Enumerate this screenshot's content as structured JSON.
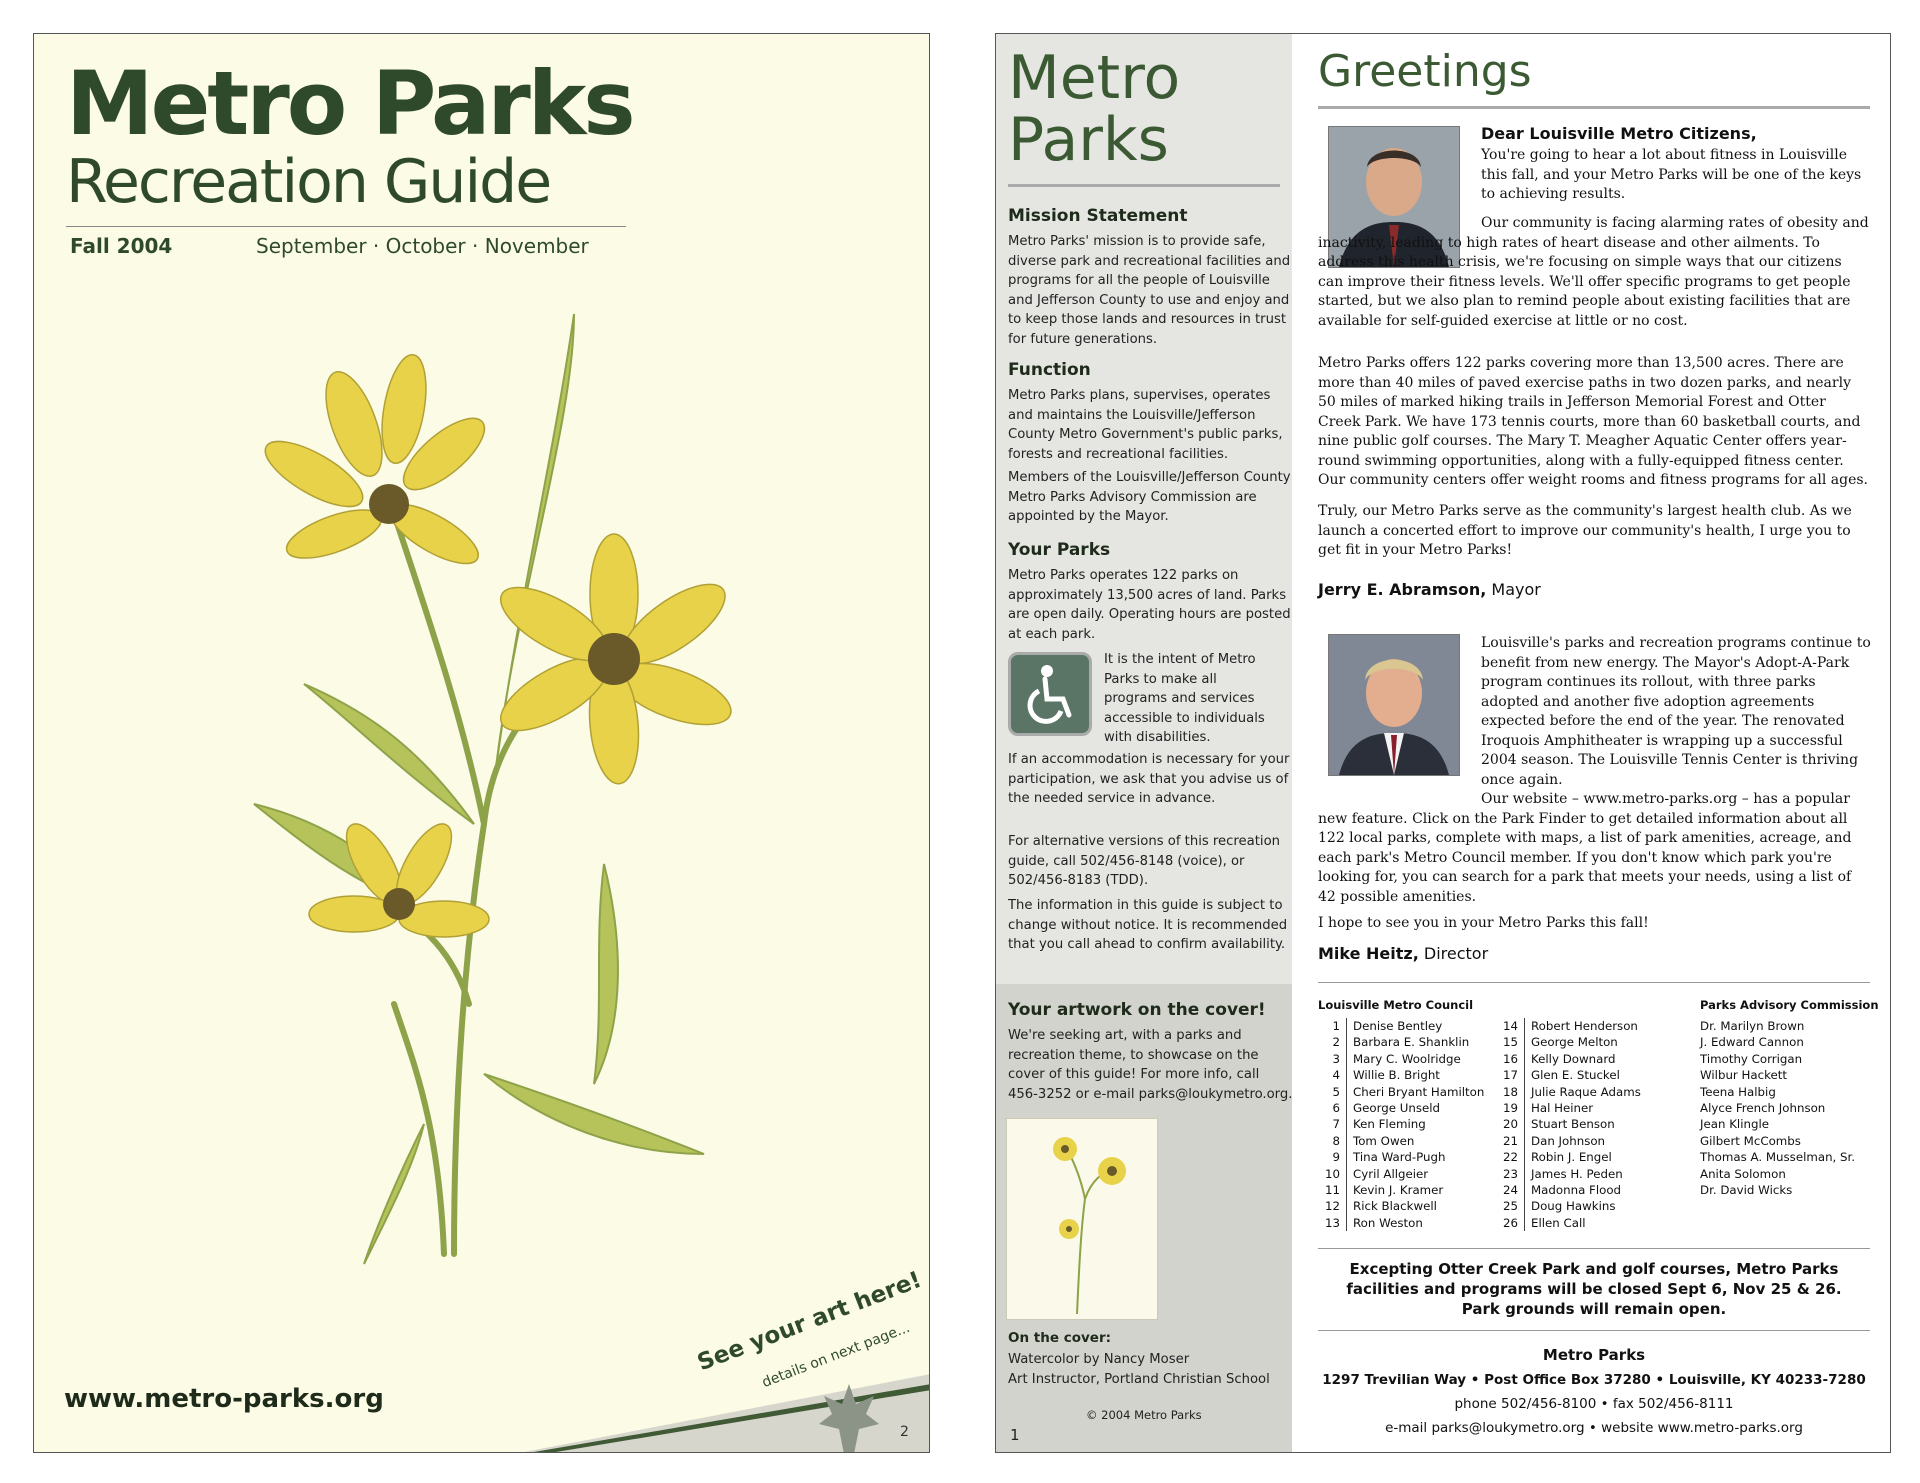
{
  "cover": {
    "title_line1": "Metro Parks",
    "title_line2": "Recreation Guide",
    "season": "Fall 2004",
    "months": "September · October · November",
    "website": "www.metro-parks.org",
    "tagline": "See your art here!",
    "tagline_sub": "details on next page...",
    "page_number": "2"
  },
  "sidebar": {
    "title_line1": "Metro",
    "title_line2": "Parks",
    "mission_heading": "Mission Statement",
    "mission_text": "Metro Parks' mission is to provide safe, diverse park and recreational facilities and programs for all the people of Louisville and Jefferson County to use and enjoy and to keep those lands and resources in trust for future generations.",
    "function_heading": "Function",
    "function_text": "Metro Parks plans, supervises, operates and maintains the Louisville/Jefferson County Metro Government's public parks, forests and recreational facilities.",
    "function_text2": "Members of the Louisville/Jefferson County Metro Parks Advisory Commission are appointed by the Mayor.",
    "parks_heading": "Your Parks",
    "parks_text": "Metro Parks operates 122 parks on approximately 13,500 acres of land. Parks are open daily. Operating hours are posted at each park.",
    "access_text": "It is the intent of Metro Parks to make all programs and services accessible to individuals with disabilities.",
    "accommodation_text": "If an accommodation is necessary for your participation, we ask that you advise us of the needed service in advance.",
    "alt_versions_text": "For alternative versions of this recreation guide, call 502/456-8148 (voice), or 502/456-8183 (TDD).",
    "change_text": "The information in this guide is subject to change without notice. It is recommended that you call ahead to confirm availability.",
    "artwork_heading": "Your artwork on the cover!",
    "artwork_text": "We're seeking art, with a parks and recreation theme, to showcase on the cover of this guide! For more info, call 456-3252 or e-mail parks@loukymetro.org.",
    "on_cover_label": "On the cover:",
    "on_cover_line1": "Watercolor by Nancy Moser",
    "on_cover_line2": "Art Instructor, Portland Christian School",
    "copyright": "© 2004 Metro Parks",
    "page_number": "1"
  },
  "greetings": {
    "heading": "Greetings",
    "salutation": "Dear Louisville Metro Citizens,",
    "mayor_p1": "You're going to hear a lot about fitness in Louisville this fall, and your Metro Parks will be one of the keys to achieving results.",
    "mayor_p2": "Our community is facing alarming rates of obesity and inactivity, leading to high rates of heart disease and other ailments. To address this health crisis, we're focusing on simple ways that our citizens can improve their fitness levels. We'll offer specific programs to get people started, but we also plan to remind people about existing facilities that are available for self-guided exercise at little or no cost.",
    "mayor_p3": "Metro Parks offers 122 parks covering more than 13,500 acres. There are more than 40 miles of paved exercise paths in two dozen parks, and nearly 50 miles of marked hiking trails in Jefferson Memorial Forest and Otter Creek Park. We have 173 tennis courts, more than 60 basketball courts, and nine public golf courses. The Mary T. Meagher Aquatic Center offers year-round swimming opportunities, along with a fully-equipped fitness center. Our community centers offer weight rooms and fitness programs for all ages.",
    "mayor_p4": "Truly, our Metro Parks serve as the community's largest health club. As we launch a concerted effort to improve our community's health, I urge you to get fit in your Metro Parks!",
    "mayor_name": "Jerry E. Abramson,",
    "mayor_title": " Mayor",
    "director_p1": "Louisville's parks and recreation programs continue to benefit from new energy. The Mayor's Adopt-A-Park program continues its rollout, with three parks adopted and another five adoption agreements expected before the end of the year. The renovated Iroquois Amphitheater is wrapping up a successful 2004 season. The Louisville Tennis Center is thriving once again.",
    "director_p2": "Our website – www.metro-parks.org – has a popular new feature. Click on the Park Finder to get detailed information about all 122 local parks, complete with maps, a list of park amenities, acreage, and each park's Metro Council member. If you don't know which park you're looking for, you can search for a park that meets your needs, using a list of 42 possible amenities.",
    "director_p3": "I hope to see you in your Metro Parks this fall!",
    "director_name": "Mike Heitz,",
    "director_title": " Director"
  },
  "council": {
    "heading": "Louisville Metro Council",
    "members_a": [
      {
        "n": "1",
        "name": "Denise Bentley"
      },
      {
        "n": "2",
        "name": "Barbara E. Shanklin"
      },
      {
        "n": "3",
        "name": "Mary C. Woolridge"
      },
      {
        "n": "4",
        "name": "Willie B. Bright"
      },
      {
        "n": "5",
        "name": "Cheri Bryant Hamilton"
      },
      {
        "n": "6",
        "name": "George Unseld"
      },
      {
        "n": "7",
        "name": "Ken Fleming"
      },
      {
        "n": "8",
        "name": "Tom Owen"
      },
      {
        "n": "9",
        "name": "Tina Ward-Pugh"
      },
      {
        "n": "10",
        "name": "Cyril Allgeier"
      },
      {
        "n": "11",
        "name": "Kevin J. Kramer"
      },
      {
        "n": "12",
        "name": "Rick Blackwell"
      },
      {
        "n": "13",
        "name": "Ron Weston"
      }
    ],
    "members_b": [
      {
        "n": "14",
        "name": "Robert Henderson"
      },
      {
        "n": "15",
        "name": "George Melton"
      },
      {
        "n": "16",
        "name": "Kelly Downard"
      },
      {
        "n": "17",
        "name": "Glen E. Stuckel"
      },
      {
        "n": "18",
        "name": "Julie Raque Adams"
      },
      {
        "n": "19",
        "name": "Hal Heiner"
      },
      {
        "n": "20",
        "name": "Stuart Benson"
      },
      {
        "n": "21",
        "name": "Dan Johnson"
      },
      {
        "n": "22",
        "name": "Robin J. Engel"
      },
      {
        "n": "23",
        "name": "James H. Peden"
      },
      {
        "n": "24",
        "name": "Madonna Flood"
      },
      {
        "n": "25",
        "name": "Doug Hawkins"
      },
      {
        "n": "26",
        "name": "Ellen Call"
      }
    ]
  },
  "commission": {
    "heading": "Parks Advisory Commission",
    "members": [
      "Dr. Marilyn Brown",
      "J. Edward Cannon",
      "Timothy Corrigan",
      "Wilbur Hackett",
      "Teena Halbig",
      "Alyce French Johnson",
      "Jean Klingle",
      "Gilbert McCombs",
      "Thomas A. Musselman, Sr.",
      "Anita Solomon",
      "Dr. David Wicks"
    ]
  },
  "closure": {
    "line1": "Excepting Otter Creek Park and golf courses, Metro Parks",
    "line2": "facilities and programs will be closed Sept 6, Nov 25 & 26.",
    "line3": "Park grounds will remain open."
  },
  "contact": {
    "name": "Metro Parks",
    "address": "1297 Trevilian Way • Post Office Box 37280 • Louisville, KY 40233-7280",
    "phone": "phone 502/456-8100 • fax 502/456-8111",
    "email_line": "e-mail parks@loukymetro.org • website www.metro-parks.org"
  },
  "colors": {
    "brand_green": "#2f4a2a",
    "cover_bg": "#fcfbe6",
    "flower_yellow": "#e8d24a",
    "sidebar_gray": "#e5e6e2"
  }
}
